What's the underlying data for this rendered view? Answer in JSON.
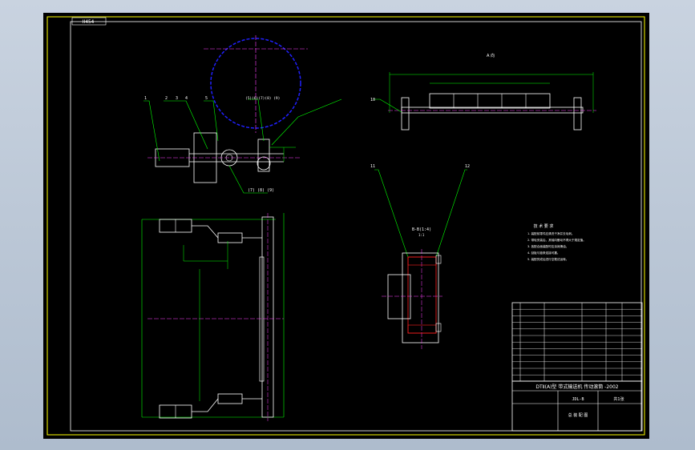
{
  "drawing": {
    "corner_label": "H454",
    "view_title_top_right": "A 向",
    "section_label": "B-B(1:4)",
    "view_scale": "1:1",
    "label_bottom_left": "(7) (8) (9)",
    "label_top_small": "(5)(6)(7)(8) (9)",
    "callouts_top_left": [
      "1",
      "2",
      "3",
      "4",
      "5"
    ],
    "callouts_section": [
      "11",
      "12"
    ],
    "callout_right_view": "10",
    "callouts_mid": [
      "3",
      "5",
      "(7)",
      "(8)",
      "(9)",
      "4"
    ],
    "tech_req_title": "技 术 要 求",
    "tech_req_lines": [
      "1. 装配前零件应清洗干净并去毛刺。",
      "2. 带轮安装后，其轴向窜动不得大于规定值。",
      "3. 各配合面装配时应涂润滑油。",
      "4. 刮板与链条连接可靠。",
      "5. 装配完成后进行空载试运转。"
    ],
    "title_main": "DTⅡ(A)型 带式输送机 传动滚筒 -2002",
    "title_sub": "JDL-B",
    "title_drawing_no": "总 装 配 图",
    "title_sheet": "共1张"
  },
  "colors": {
    "background": "#000000",
    "green": "#00ff00",
    "white": "#ffffff",
    "magenta": "#ff40ff",
    "yellow": "#ffff00",
    "blue": "#2020ff",
    "red": "#ff2020",
    "cyan": "#00ffff"
  }
}
